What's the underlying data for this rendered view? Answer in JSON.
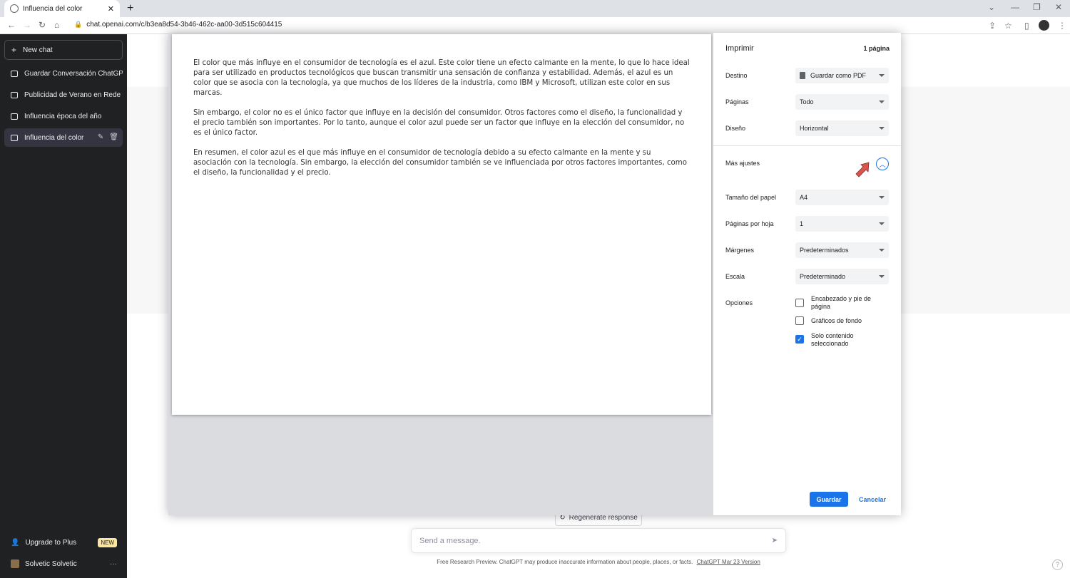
{
  "browser": {
    "tab_title": "Influencia del color",
    "url": "chat.openai.com/c/b3ea8d54-3b46-462c-aa00-3d515c604415",
    "new_tab_icon": "+",
    "close_tab_icon": "✕",
    "window_controls": [
      "⌄",
      "—",
      "❐",
      "✕"
    ],
    "nav_icons": [
      "←",
      "→",
      "↻",
      "⌂"
    ],
    "lock_icon": "🔒",
    "toolbar_icons": [
      "⇪",
      "☆",
      "▯",
      "⋮"
    ]
  },
  "sidebar": {
    "new_chat": "New chat",
    "chats": [
      {
        "label": "Guardar Conversación ChatGP"
      },
      {
        "label": "Publicidad de Verano en Rede"
      },
      {
        "label": "Influencia época del año"
      },
      {
        "label": "Influencia del color"
      }
    ],
    "edit_icon": "✎",
    "delete_icon": "🗑",
    "upgrade": "Upgrade to Plus",
    "new_badge": "NEW",
    "user_name": "Solvetic Solvetic",
    "more_icon": "···",
    "person_icon": "👤",
    "plus_icon": "+"
  },
  "main": {
    "regenerate": "Regenerate response",
    "regenerate_icon": "↻",
    "message_placeholder": "Send a message.",
    "send_icon": "➤",
    "footer_text": "Free Research Preview. ChatGPT may produce inaccurate information about people, places, or facts.",
    "footer_link": "ChatGPT Mar 23 Version",
    "help_icon": "?"
  },
  "preview": {
    "paragraphs": [
      "El color que más influye en el consumidor de tecnología es el azul. Este color tiene un efecto calmante en la mente, lo que lo hace ideal para ser utilizado en productos tecnológicos que buscan transmitir una sensación de confianza y estabilidad. Además, el azul es un color que se asocia con la tecnología, ya que muchos de los líderes de la industria, como IBM y Microsoft, utilizan este color en sus marcas.",
      "Sin embargo, el color no es el único factor que influye en la decisión del consumidor. Otros factores como el diseño, la funcionalidad y el precio también son importantes. Por lo tanto, aunque el color azul puede ser un factor que influye en la elección del consumidor, no es el único factor.",
      "En resumen, el color azul es el que más influye en el consumidor de tecnología debido a su efecto calmante en la mente y su asociación con la tecnología. Sin embargo, la elección del consumidor también se ve influenciada por otros factores importantes, como el diseño, la funcionalidad y el precio."
    ]
  },
  "print": {
    "title": "Imprimir",
    "page_count": "1 página",
    "destino_label": "Destino",
    "destino_value": "Guardar como PDF",
    "paginas_label": "Páginas",
    "paginas_value": "Todo",
    "diseno_label": "Diseño",
    "diseno_value": "Horizontal",
    "mas_ajustes": "Más ajustes",
    "expand_icon": "︿",
    "tamano_label": "Tamaño del papel",
    "tamano_value": "A4",
    "pph_label": "Páginas por hoja",
    "pph_value": "1",
    "margenes_label": "Márgenes",
    "margenes_value": "Predeterminados",
    "escala_label": "Escala",
    "escala_value": "Predeterminado",
    "opciones_label": "Opciones",
    "options": [
      {
        "label": "Encabezado y pie de página",
        "checked": false
      },
      {
        "label": "Gráficos de fondo",
        "checked": false
      },
      {
        "label": "Solo contenido seleccionado",
        "checked": true
      }
    ],
    "check_mark": "✓",
    "save": "Guardar",
    "cancel": "Cancelar"
  },
  "colors": {
    "accent": "#1a73e8",
    "sidebar_bg": "#202123",
    "annotation_arrow": "#d9534f"
  }
}
